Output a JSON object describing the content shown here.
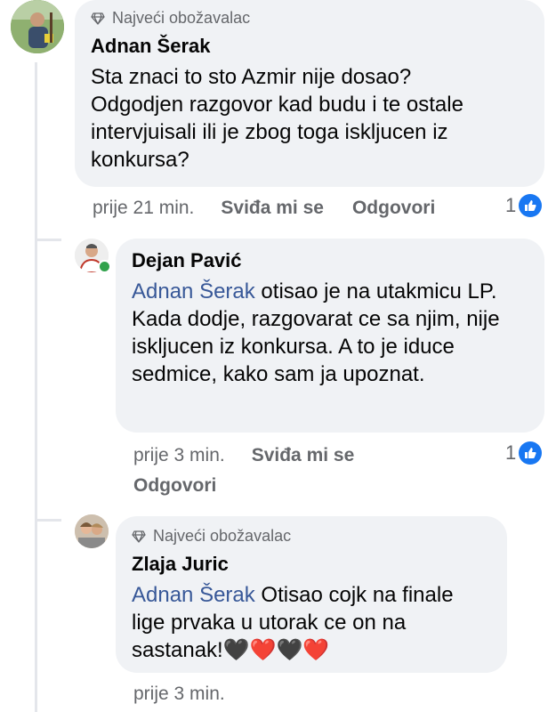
{
  "comments": [
    {
      "badge": "Najveći obožavalac",
      "author": "Adnan Šerak",
      "text": "Sta znaci to sto Azmir nije dosao? Odgodjen razgovor kad budu i te ostale intervjuisali ili je zbog toga iskljucen iz konkursa?",
      "time": "prije 21 min.",
      "like_label": "Sviđa mi se",
      "reply_label": "Odgovori",
      "reaction_count": "1"
    },
    {
      "author": "Dejan Pavić",
      "mention": "Adnan Šerak",
      "text": " otisao je na utakmicu LP. Kada dodje, razgovarat ce sa njim, nije iskljucen iz konkursa. A to je iduce sedmice, kako sam ja upoznat.",
      "time": "prije 3 min.",
      "like_label": "Sviđa mi se",
      "reply_label": "Odgovori",
      "reaction_count": "1"
    },
    {
      "badge": "Najveći obožavalac",
      "author": "Zlaja Juric",
      "mention": "Adnan Šerak",
      "text": " Otisao cojk na finale lige prvaka u utorak ce on na sastanak!🖤❤️🖤❤️",
      "time": "prije 3 min."
    }
  ],
  "colors": {
    "like_blue": "#1877f2",
    "mention": "#385898",
    "bubble": "#f0f2f5",
    "online": "#31a24c"
  }
}
